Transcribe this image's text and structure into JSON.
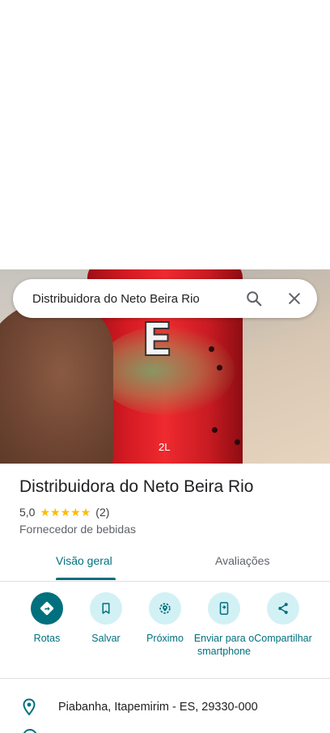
{
  "search": {
    "query": "Distribuidora do Neto Beira Rio"
  },
  "place": {
    "name": "Distribuidora do Neto Beira Rio",
    "rating": "5,0",
    "stars": 5,
    "reviews_count": "(2)",
    "category": "Fornecedor de bebidas"
  },
  "photo": {
    "can_letters": "E",
    "volume": "2L"
  },
  "tabs": [
    "Visão geral",
    "Avaliações"
  ],
  "actions": {
    "directions": "Rotas",
    "save": "Salvar",
    "nearby": "Próximo",
    "send": "Enviar para o smartphone",
    "share": "Compartilhar"
  },
  "address": "Piabanha, Itapemirim - ES, 29330-000",
  "colors": {
    "accent": "#00707e",
    "star": "#fbbc04",
    "chip_bg": "#d2f1f5"
  },
  "icons": {
    "search": "search-icon",
    "close": "close-icon",
    "directions": "directions-icon",
    "bookmark": "bookmark-icon",
    "nearby": "nearby-icon",
    "send": "send-to-phone-icon",
    "share": "share-icon",
    "pin": "location-pin-icon"
  }
}
